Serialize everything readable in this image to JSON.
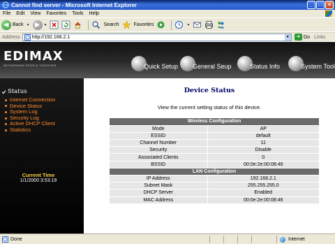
{
  "window": {
    "title": "Cannot find server - Microsoft Internet Explorer",
    "buttons": {
      "minimize": "_",
      "maximize": "□",
      "close": "×"
    }
  },
  "menubar": [
    "File",
    "Edit",
    "View",
    "Favorites",
    "Tools",
    "Help"
  ],
  "toolbar": {
    "back": "Back",
    "search": "Search",
    "favorites": "Favorites"
  },
  "address": {
    "label": "Address",
    "url": "http://192.168.2.1",
    "go": "Go",
    "links": "Links"
  },
  "router": {
    "logo": "EDIMAX",
    "tagline": "NETWORKING PEOPLE TOGETHER",
    "nav": [
      "Quick Setup",
      "General Seup",
      "Status Info",
      "System Tools"
    ],
    "sidebar": {
      "heading": "Status",
      "items": [
        "Internet Connection",
        "Device Status",
        "System Log",
        "Security Log",
        "Active DHCP Client",
        "Statistics"
      ],
      "time_label": "Current Time",
      "time_value": "1/1/2000 3:53:19"
    },
    "page_title": "Device Status",
    "description": "View the current setting status of this device.",
    "wireless": {
      "heading": "Wireless Configuration",
      "rows": [
        {
          "key": "Mode",
          "value": "AP"
        },
        {
          "key": "ESSID",
          "value": "default"
        },
        {
          "key": "Channel Number",
          "value": "11"
        },
        {
          "key": "Security",
          "value": "Disable"
        },
        {
          "key": "Associated Clients",
          "value": "0"
        },
        {
          "key": "BSSID",
          "value": "00:0e:2e:00:08:46"
        }
      ]
    },
    "lan": {
      "heading": "LAN Configuration",
      "rows": [
        {
          "key": "IP Address",
          "value": "192.168.2.1"
        },
        {
          "key": "Subnet Mask",
          "value": "255.255.255.0"
        },
        {
          "key": "DHCP Server",
          "value": "Enabled"
        },
        {
          "key": "MAC Address",
          "value": "00:0e:2e:00:08:46"
        }
      ]
    }
  },
  "statusbar": {
    "status": "Done",
    "zone": "Internet"
  },
  "colors": {
    "menu_link": "#ff8a2a",
    "time_label": "#ffd23a",
    "title_blue": "#00006a",
    "table_header": "#6a6a6a",
    "table_cell": "#e6e6e6"
  }
}
